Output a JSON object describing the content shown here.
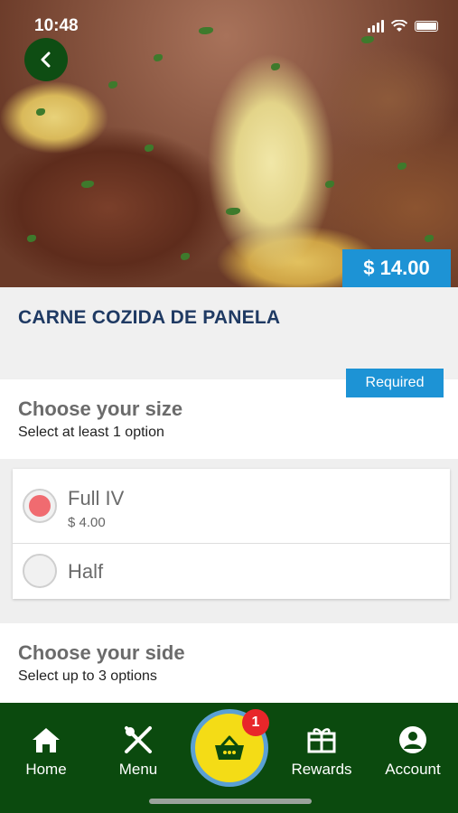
{
  "status_bar": {
    "time": "10:48"
  },
  "item": {
    "price": "$ 14.00",
    "name": "CARNE COZIDA DE PANELA"
  },
  "size_group": {
    "badge": "Required",
    "title": "Choose your size",
    "subtitle": "Select at least 1 option",
    "options": [
      {
        "label": "Full IV",
        "price": "$ 4.00",
        "selected": true
      },
      {
        "label": "Half",
        "selected": false
      }
    ]
  },
  "side_group": {
    "title": "Choose your side",
    "subtitle": "Select up to 3 options"
  },
  "nav": {
    "items": [
      {
        "label": "Home",
        "icon": "home-icon"
      },
      {
        "label": "Menu",
        "icon": "fork-knife-icon"
      },
      {
        "label": "Rewards",
        "icon": "gift-icon"
      },
      {
        "label": "Account",
        "icon": "account-icon"
      }
    ],
    "cart_count": "1"
  },
  "colors": {
    "brand_green": "#0b4a0e",
    "accent_blue": "#1d93d5",
    "cart_yellow": "#f4dc16",
    "selected_radio": "#f06b70",
    "title_navy": "#1f3a63"
  }
}
